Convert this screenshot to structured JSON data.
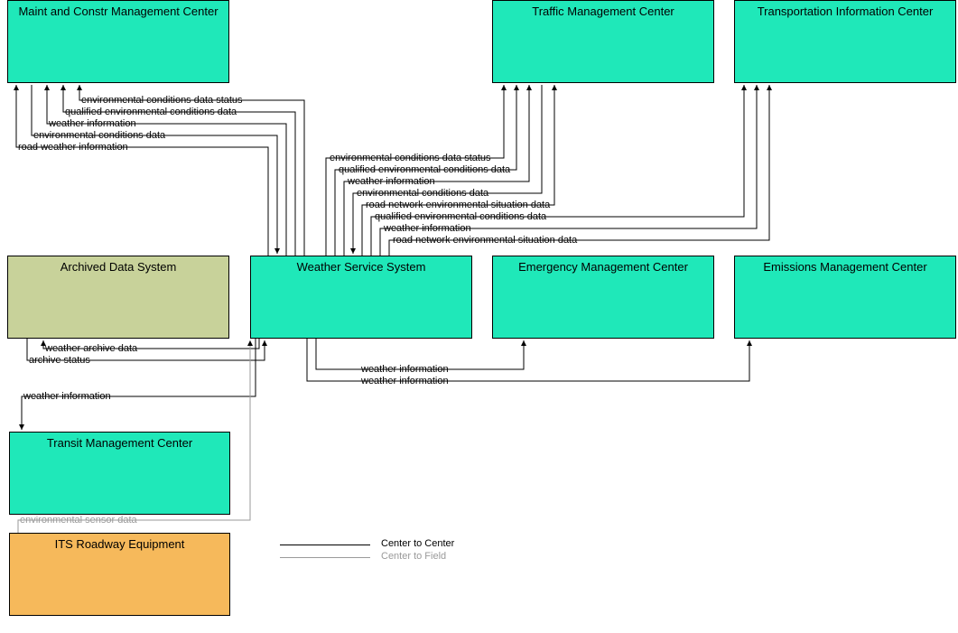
{
  "boxes": {
    "maint": {
      "label": "Maint and Constr Management Center"
    },
    "traffic": {
      "label": "Traffic Management Center"
    },
    "tic": {
      "label": "Transportation Information Center"
    },
    "archived": {
      "label": "Archived Data System"
    },
    "weather": {
      "label": "Weather Service System"
    },
    "emerg": {
      "label": "Emergency Management Center"
    },
    "emiss": {
      "label": "Emissions Management Center"
    },
    "transit": {
      "label": "Transit Management Center"
    },
    "its": {
      "label": "ITS Roadway Equipment"
    }
  },
  "flows": {
    "maint": [
      "environmental conditions data status",
      "qualified environmental conditions data",
      "weather information",
      "environmental conditions data",
      "road weather information"
    ],
    "traffic": [
      "environmental conditions data status",
      "qualified environmental conditions data",
      "weather information",
      "environmental conditions data",
      "road network environmental situation data"
    ],
    "tic": [
      "qualified environmental conditions data",
      "weather information",
      "road network environmental situation data"
    ],
    "archived": [
      "weather archive data",
      "archive status"
    ],
    "emerg": "weather information",
    "emiss": "weather information",
    "transit": "weather information",
    "its": "environmental sensor data"
  },
  "legend": {
    "c2c": "Center to Center",
    "c2f": "Center to Field"
  },
  "colors": {
    "teal": "#1fe8b9",
    "olive": "#c8d29a",
    "orange": "#f6b95b"
  }
}
